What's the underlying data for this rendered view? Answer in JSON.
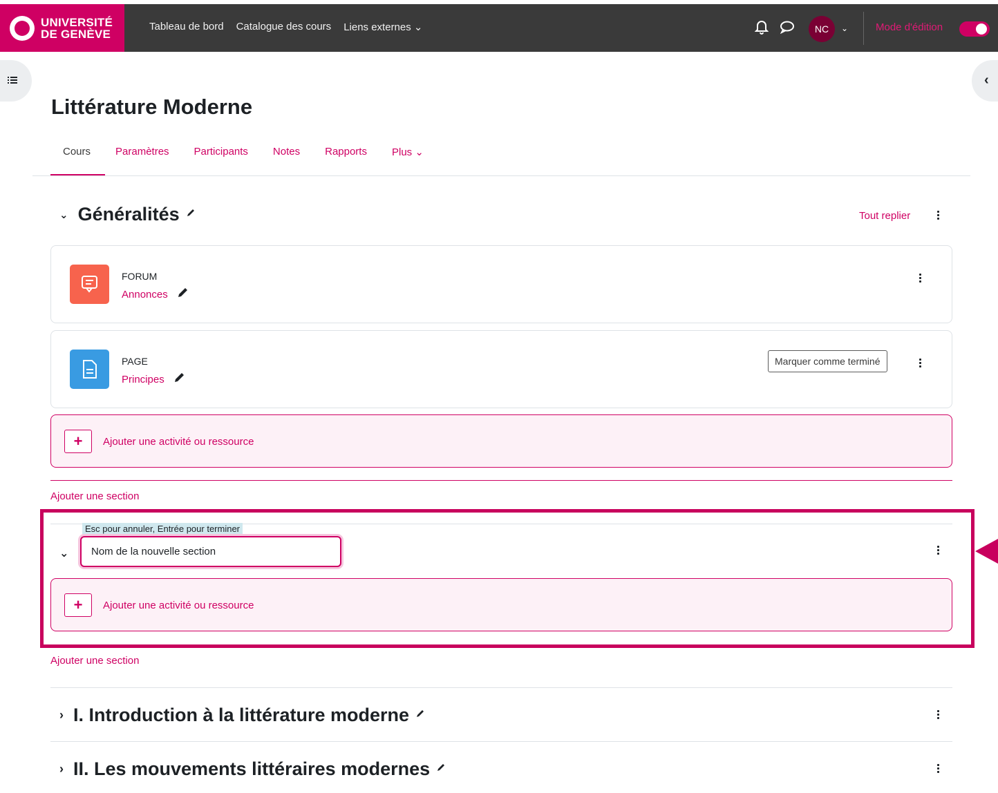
{
  "brand": {
    "line1": "UNIVERSITÉ",
    "line2": "DE GENÈVE"
  },
  "navbar": {
    "links": [
      "Tableau de bord",
      "Catalogue des cours",
      "Liens externes ⌄"
    ],
    "avatar_initials": "NC",
    "edit_mode_label": "Mode d'édition"
  },
  "course": {
    "title": "Littérature Moderne",
    "tabs": [
      "Cours",
      "Paramètres",
      "Participants",
      "Notes",
      "Rapports",
      "Plus ⌄"
    ]
  },
  "general_section": {
    "title": "Généralités",
    "collapse_all": "Tout replier",
    "activities": [
      {
        "type": "FORUM",
        "name": "Annonces",
        "icon": "forum-icon",
        "color": "#f7634d"
      },
      {
        "type": "PAGE",
        "name": "Principes",
        "icon": "page-icon",
        "color": "#399be2",
        "completion_button": "Marquer comme terminé"
      }
    ],
    "add_activity": "Ajouter une activité ou ressource"
  },
  "add_section_1": "Ajouter une section",
  "new_section": {
    "hint": "Esc pour annuler, Entrée pour terminer",
    "input_value": "Nom de la nouvelle section",
    "add_activity": "Ajouter une activité ou ressource"
  },
  "add_section_2": "Ajouter une section",
  "sections": [
    {
      "title": "I. Introduction à la littérature moderne"
    },
    {
      "title": "II. Les mouvements littéraires modernes"
    }
  ],
  "colors": {
    "accent": "#cf0063",
    "navbar": "#3a3a3a"
  }
}
